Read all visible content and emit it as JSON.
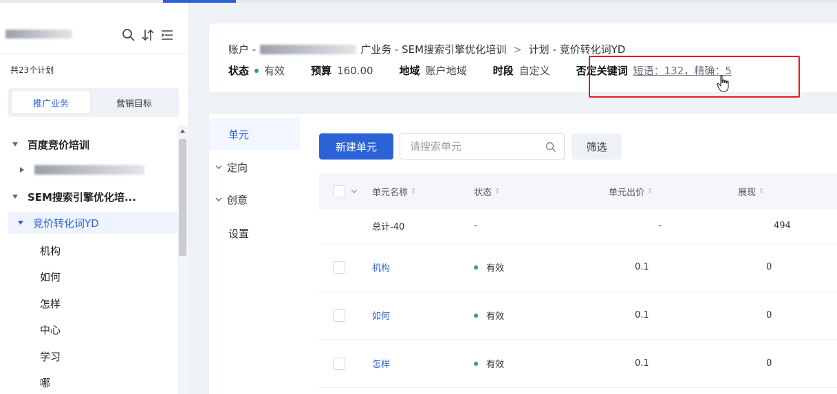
{
  "sidebar": {
    "plan_count": "共23个计划",
    "segments": {
      "active": "推广业务",
      "inactive": "营销目标"
    },
    "tree": {
      "plan1": "百度竞价培训",
      "plan2": "SEM搜索引擎优化培...",
      "selected_plan": "竞价转化词YD",
      "units": [
        "机构",
        "如何",
        "怎样",
        "中心",
        "学习",
        "哪"
      ]
    }
  },
  "header": {
    "breadcrumb": {
      "account_prefix": "账户 -",
      "business": "广业务 - SEM搜索引擎优化培训",
      "separator": ">",
      "plan": "计划 - 竞价转化词YD"
    },
    "status_label": "状态",
    "status_value": "有效",
    "budget_label": "预算",
    "budget_value": "160.00",
    "region_label": "地域",
    "region_value": "账户地域",
    "schedule_label": "时段",
    "schedule_value": "自定义",
    "negative_label": "否定关键词",
    "negative_value": "短语：132，精确：5"
  },
  "tabs": {
    "unit": "单元",
    "targeting": "定向",
    "creative": "创意",
    "settings": "设置"
  },
  "toolbar": {
    "new_unit": "新建单元",
    "search_placeholder": "请搜索单元",
    "filter": "筛选"
  },
  "table": {
    "columns": {
      "name": "单元名称",
      "status": "状态",
      "bid": "单元出价",
      "impressions": "展现"
    },
    "total": {
      "name": "总计-40",
      "status": "-",
      "bid": "-",
      "impressions": "494"
    },
    "rows": [
      {
        "name": "机构",
        "status": "有效",
        "bid": "0.1",
        "impressions": "0"
      },
      {
        "name": "如何",
        "status": "有效",
        "bid": "0.1",
        "impressions": "0"
      },
      {
        "name": "怎样",
        "status": "有效",
        "bid": "0.1",
        "impressions": "0"
      }
    ]
  },
  "colors": {
    "accent": "#2b62d6",
    "success": "#1fa971",
    "highlight": "#e11d1d"
  }
}
